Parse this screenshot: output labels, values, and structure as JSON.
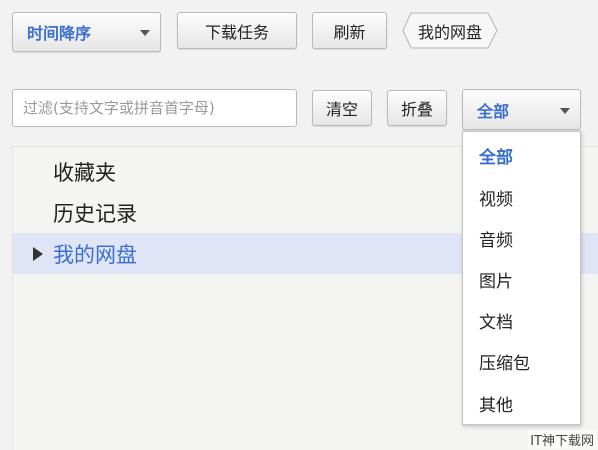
{
  "toolbar": {
    "sort_select": "时间降序",
    "download_tasks": "下载任务",
    "refresh": "刷新",
    "breadcrumb": "我的网盘"
  },
  "filter_bar": {
    "placeholder": "过滤(支持文字或拼音首字母)",
    "value": "",
    "clear": "清空",
    "collapse": "折叠",
    "type_select": "全部"
  },
  "tree": {
    "items": [
      {
        "label": "收藏夹"
      },
      {
        "label": "历史记录"
      },
      {
        "label": "我的网盘",
        "selected": true,
        "expandable": true
      }
    ]
  },
  "type_dropdown": {
    "options": [
      "全部",
      "视频",
      "音频",
      "图片",
      "文档",
      "压缩包",
      "其他"
    ],
    "selected_index": 0
  },
  "watermark": "IT神下载网",
  "colors": {
    "accent": "#3b6fd1",
    "selected_row": "#dfe5f7"
  }
}
